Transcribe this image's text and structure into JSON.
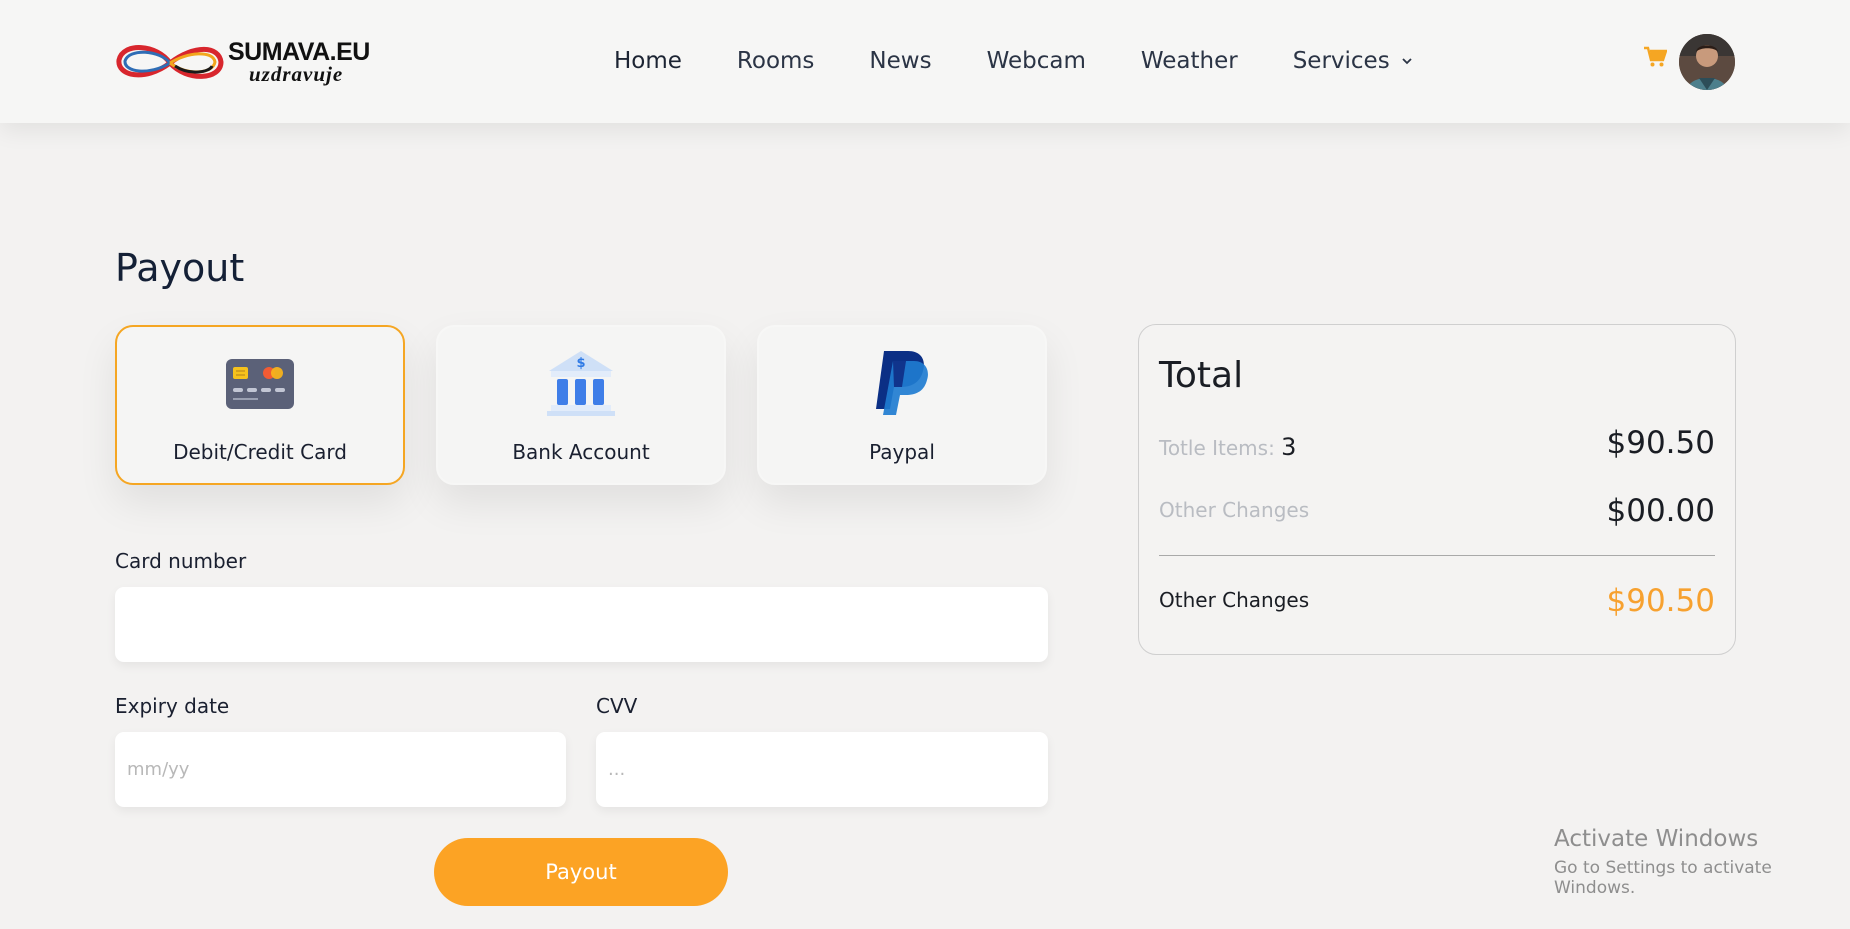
{
  "brand": {
    "name": "SUMAVA.EU",
    "tagline": "uzdravuje"
  },
  "nav": {
    "items": [
      {
        "label": "Home",
        "active": true
      },
      {
        "label": "Rooms"
      },
      {
        "label": "News"
      },
      {
        "label": "Webcam"
      },
      {
        "label": "Weather"
      },
      {
        "label": "Services",
        "dropdown": true
      }
    ]
  },
  "header": {
    "cart_icon": "cart-icon",
    "avatar": "user-avatar"
  },
  "page": {
    "title": "Payout"
  },
  "methods": [
    {
      "label": "Debit/Credit Card",
      "icon": "credit-card-icon",
      "selected": true
    },
    {
      "label": "Bank Account",
      "icon": "bank-icon",
      "selected": false
    },
    {
      "label": "Paypal",
      "icon": "paypal-icon",
      "selected": false
    }
  ],
  "form": {
    "card_number": {
      "label": "Card number",
      "value": "",
      "placeholder": ""
    },
    "expiry": {
      "label": "Expiry date",
      "value": "",
      "placeholder": "mm/yy"
    },
    "cvv": {
      "label": "CVV",
      "value": "",
      "placeholder": "..."
    },
    "submit_label": "Payout"
  },
  "total": {
    "title": "Total",
    "items_label": "Totle Items:",
    "items_count": "3",
    "items_value": "$90.50",
    "other_label": "Other Changes",
    "other_value": "$00.00",
    "final_label": "Other Changes",
    "final_value": "$90.50",
    "accent_color": "#f7a12f"
  },
  "colors": {
    "accent": "#fca324",
    "selected_border": "#f5a623"
  },
  "watermark": {
    "line1": "Activate Windows",
    "line2": "Go to Settings to activate Windows."
  }
}
